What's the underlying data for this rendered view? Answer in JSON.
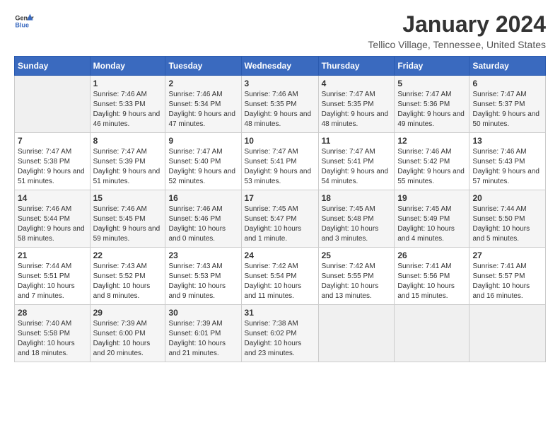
{
  "header": {
    "logo_general": "General",
    "logo_blue": "Blue",
    "title": "January 2024",
    "subtitle": "Tellico Village, Tennessee, United States"
  },
  "calendar": {
    "weekdays": [
      "Sunday",
      "Monday",
      "Tuesday",
      "Wednesday",
      "Thursday",
      "Friday",
      "Saturday"
    ],
    "weeks": [
      [
        {
          "day": "",
          "sunrise": "",
          "sunset": "",
          "daylight": ""
        },
        {
          "day": "1",
          "sunrise": "Sunrise: 7:46 AM",
          "sunset": "Sunset: 5:33 PM",
          "daylight": "Daylight: 9 hours and 46 minutes."
        },
        {
          "day": "2",
          "sunrise": "Sunrise: 7:46 AM",
          "sunset": "Sunset: 5:34 PM",
          "daylight": "Daylight: 9 hours and 47 minutes."
        },
        {
          "day": "3",
          "sunrise": "Sunrise: 7:46 AM",
          "sunset": "Sunset: 5:35 PM",
          "daylight": "Daylight: 9 hours and 48 minutes."
        },
        {
          "day": "4",
          "sunrise": "Sunrise: 7:47 AM",
          "sunset": "Sunset: 5:35 PM",
          "daylight": "Daylight: 9 hours and 48 minutes."
        },
        {
          "day": "5",
          "sunrise": "Sunrise: 7:47 AM",
          "sunset": "Sunset: 5:36 PM",
          "daylight": "Daylight: 9 hours and 49 minutes."
        },
        {
          "day": "6",
          "sunrise": "Sunrise: 7:47 AM",
          "sunset": "Sunset: 5:37 PM",
          "daylight": "Daylight: 9 hours and 50 minutes."
        }
      ],
      [
        {
          "day": "7",
          "sunrise": "Sunrise: 7:47 AM",
          "sunset": "Sunset: 5:38 PM",
          "daylight": "Daylight: 9 hours and 51 minutes."
        },
        {
          "day": "8",
          "sunrise": "Sunrise: 7:47 AM",
          "sunset": "Sunset: 5:39 PM",
          "daylight": "Daylight: 9 hours and 51 minutes."
        },
        {
          "day": "9",
          "sunrise": "Sunrise: 7:47 AM",
          "sunset": "Sunset: 5:40 PM",
          "daylight": "Daylight: 9 hours and 52 minutes."
        },
        {
          "day": "10",
          "sunrise": "Sunrise: 7:47 AM",
          "sunset": "Sunset: 5:41 PM",
          "daylight": "Daylight: 9 hours and 53 minutes."
        },
        {
          "day": "11",
          "sunrise": "Sunrise: 7:47 AM",
          "sunset": "Sunset: 5:41 PM",
          "daylight": "Daylight: 9 hours and 54 minutes."
        },
        {
          "day": "12",
          "sunrise": "Sunrise: 7:46 AM",
          "sunset": "Sunset: 5:42 PM",
          "daylight": "Daylight: 9 hours and 55 minutes."
        },
        {
          "day": "13",
          "sunrise": "Sunrise: 7:46 AM",
          "sunset": "Sunset: 5:43 PM",
          "daylight": "Daylight: 9 hours and 57 minutes."
        }
      ],
      [
        {
          "day": "14",
          "sunrise": "Sunrise: 7:46 AM",
          "sunset": "Sunset: 5:44 PM",
          "daylight": "Daylight: 9 hours and 58 minutes."
        },
        {
          "day": "15",
          "sunrise": "Sunrise: 7:46 AM",
          "sunset": "Sunset: 5:45 PM",
          "daylight": "Daylight: 9 hours and 59 minutes."
        },
        {
          "day": "16",
          "sunrise": "Sunrise: 7:46 AM",
          "sunset": "Sunset: 5:46 PM",
          "daylight": "Daylight: 10 hours and 0 minutes."
        },
        {
          "day": "17",
          "sunrise": "Sunrise: 7:45 AM",
          "sunset": "Sunset: 5:47 PM",
          "daylight": "Daylight: 10 hours and 1 minute."
        },
        {
          "day": "18",
          "sunrise": "Sunrise: 7:45 AM",
          "sunset": "Sunset: 5:48 PM",
          "daylight": "Daylight: 10 hours and 3 minutes."
        },
        {
          "day": "19",
          "sunrise": "Sunrise: 7:45 AM",
          "sunset": "Sunset: 5:49 PM",
          "daylight": "Daylight: 10 hours and 4 minutes."
        },
        {
          "day": "20",
          "sunrise": "Sunrise: 7:44 AM",
          "sunset": "Sunset: 5:50 PM",
          "daylight": "Daylight: 10 hours and 5 minutes."
        }
      ],
      [
        {
          "day": "21",
          "sunrise": "Sunrise: 7:44 AM",
          "sunset": "Sunset: 5:51 PM",
          "daylight": "Daylight: 10 hours and 7 minutes."
        },
        {
          "day": "22",
          "sunrise": "Sunrise: 7:43 AM",
          "sunset": "Sunset: 5:52 PM",
          "daylight": "Daylight: 10 hours and 8 minutes."
        },
        {
          "day": "23",
          "sunrise": "Sunrise: 7:43 AM",
          "sunset": "Sunset: 5:53 PM",
          "daylight": "Daylight: 10 hours and 9 minutes."
        },
        {
          "day": "24",
          "sunrise": "Sunrise: 7:42 AM",
          "sunset": "Sunset: 5:54 PM",
          "daylight": "Daylight: 10 hours and 11 minutes."
        },
        {
          "day": "25",
          "sunrise": "Sunrise: 7:42 AM",
          "sunset": "Sunset: 5:55 PM",
          "daylight": "Daylight: 10 hours and 13 minutes."
        },
        {
          "day": "26",
          "sunrise": "Sunrise: 7:41 AM",
          "sunset": "Sunset: 5:56 PM",
          "daylight": "Daylight: 10 hours and 15 minutes."
        },
        {
          "day": "27",
          "sunrise": "Sunrise: 7:41 AM",
          "sunset": "Sunset: 5:57 PM",
          "daylight": "Daylight: 10 hours and 16 minutes."
        }
      ],
      [
        {
          "day": "28",
          "sunrise": "Sunrise: 7:40 AM",
          "sunset": "Sunset: 5:58 PM",
          "daylight": "Daylight: 10 hours and 18 minutes."
        },
        {
          "day": "29",
          "sunrise": "Sunrise: 7:39 AM",
          "sunset": "Sunset: 6:00 PM",
          "daylight": "Daylight: 10 hours and 20 minutes."
        },
        {
          "day": "30",
          "sunrise": "Sunrise: 7:39 AM",
          "sunset": "Sunset: 6:01 PM",
          "daylight": "Daylight: 10 hours and 21 minutes."
        },
        {
          "day": "31",
          "sunrise": "Sunrise: 7:38 AM",
          "sunset": "Sunset: 6:02 PM",
          "daylight": "Daylight: 10 hours and 23 minutes."
        },
        {
          "day": "",
          "sunrise": "",
          "sunset": "",
          "daylight": ""
        },
        {
          "day": "",
          "sunrise": "",
          "sunset": "",
          "daylight": ""
        },
        {
          "day": "",
          "sunrise": "",
          "sunset": "",
          "daylight": ""
        }
      ]
    ]
  }
}
